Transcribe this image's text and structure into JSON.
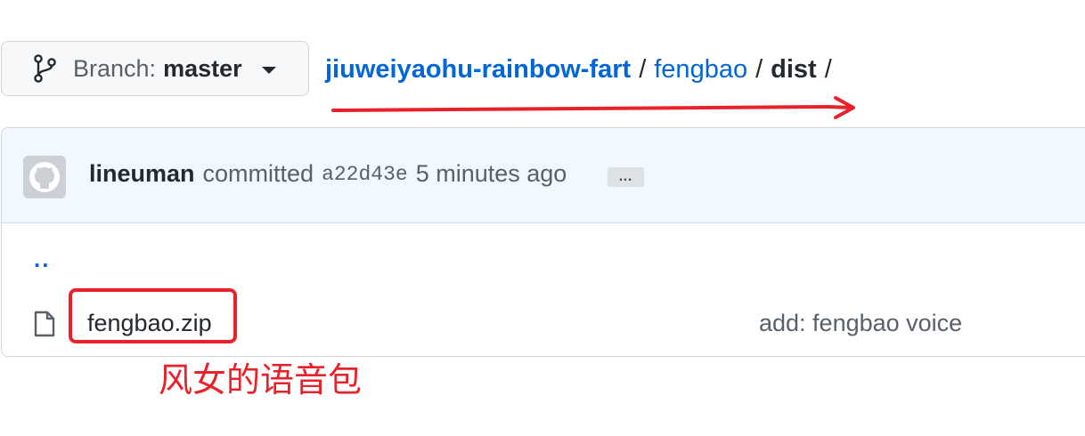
{
  "branch": {
    "prefix": "Branch:",
    "name": "master",
    "icon": "git-branch-icon"
  },
  "breadcrumb": {
    "repo": "jiuweiyaohu-rainbow-fart",
    "folder": "fengbao",
    "current": "dist",
    "separator": "/"
  },
  "commit": {
    "author": "lineuman",
    "verb": "committed",
    "sha": "a22d43e",
    "time": "5 minutes ago",
    "ellipsis": "…"
  },
  "files": {
    "parent_link": "..",
    "rows": [
      {
        "name": "fengbao.zip",
        "icon": "file-icon",
        "message": "add: fengbao voice"
      }
    ]
  },
  "annotation": {
    "label": "风女的语音包",
    "color": "#e8222a"
  },
  "colors": {
    "link": "#0366d6",
    "commit_bar_bg": "#f1f8ff",
    "border": "#d1d5da"
  }
}
